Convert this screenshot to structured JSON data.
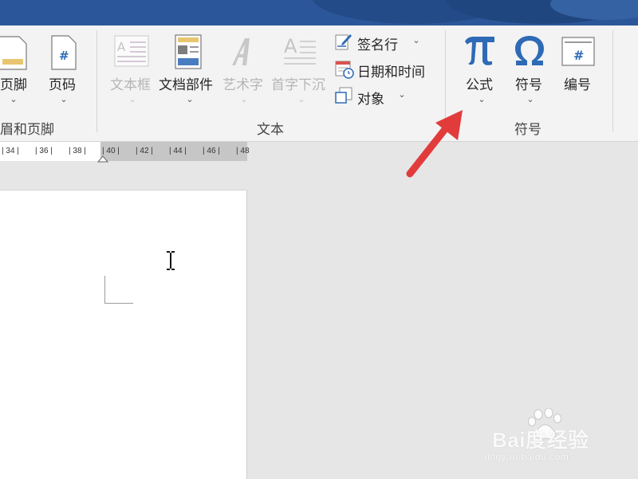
{
  "ribbon": {
    "header_footer_group": {
      "footer_label": "页脚",
      "page_number_label": "页码",
      "group_label": "眉和页脚"
    },
    "text_group": {
      "text_box_label": "文本框",
      "quick_parts_label": "文档部件",
      "wordart_label": "艺术字",
      "drop_cap_label": "首字下沉",
      "signature_line_label": "签名行",
      "date_time_label": "日期和时间",
      "object_label": "对象",
      "group_label": "文本"
    },
    "symbols_group": {
      "equation_label": "公式",
      "symbol_label": "符号",
      "numbering_label": "编号",
      "group_label": "符号"
    },
    "dropdown_chevron": "⌄"
  },
  "ruler": {
    "ticks": [
      "| 34 |",
      "| 36 |",
      "| 38 |",
      "| 40 |",
      "| 42 |",
      "| 44 |",
      "| 46 |",
      "| 48"
    ]
  },
  "watermark": {
    "brand": "Bai度经验",
    "url": "jingyan.baidu.com"
  },
  "colors": {
    "title_bar": "#2b579a",
    "ribbon_bg": "#f3f3f3",
    "accent_blue": "#2e6ab5",
    "arrow_red": "#e23b3b",
    "workspace_bg": "#e6e6e6"
  },
  "icons": {
    "equation": "pi-icon",
    "symbol": "omega-icon",
    "numbering": "number-sign-icon",
    "signature_line": "signature-line-icon",
    "date_time": "calendar-clock-icon",
    "object": "object-icon",
    "pointer": "text-cursor-icon",
    "annotation": "red-arrow-icon"
  }
}
